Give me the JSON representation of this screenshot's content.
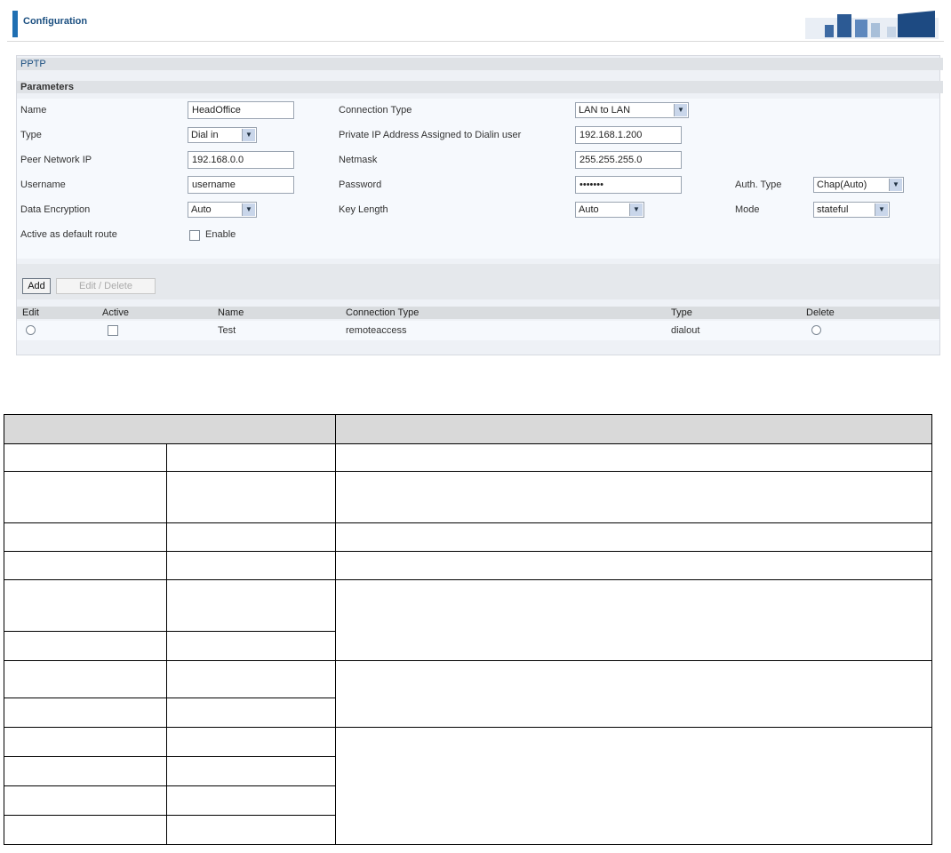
{
  "header": {
    "title": "Configuration"
  },
  "panel": {
    "section_title": "PPTP",
    "parameters_label": "Parameters",
    "fields": {
      "name": {
        "label": "Name",
        "value": "HeadOffice"
      },
      "connection_type": {
        "label": "Connection Type",
        "value": "LAN to LAN"
      },
      "type": {
        "label": "Type",
        "value": "Dial in"
      },
      "private_ip": {
        "label": "Private IP Address Assigned to Dialin user",
        "value": "192.168.1.200"
      },
      "peer_network_ip": {
        "label": "Peer Network IP",
        "value": "192.168.0.0"
      },
      "netmask": {
        "label": "Netmask",
        "value": "255.255.255.0"
      },
      "username": {
        "label": "Username",
        "value": "username"
      },
      "password": {
        "label": "Password",
        "value": "•••••••"
      },
      "auth_type": {
        "label": "Auth. Type",
        "value": "Chap(Auto)"
      },
      "data_encryption": {
        "label": "Data Encryption",
        "value": "Auto"
      },
      "key_length": {
        "label": "Key Length",
        "value": "Auto"
      },
      "mode": {
        "label": "Mode",
        "value": "stateful"
      },
      "default_route": {
        "label": "Active as default route",
        "checkbox_label": "Enable"
      }
    },
    "buttons": {
      "add": "Add",
      "edit_delete": "Edit / Delete"
    },
    "list": {
      "headers": [
        "Edit",
        "Active",
        "Name",
        "Connection Type",
        "Type",
        "Delete"
      ],
      "rows": [
        {
          "name": "Test",
          "connection_type": "remoteaccess",
          "type": "dialout"
        }
      ]
    }
  }
}
